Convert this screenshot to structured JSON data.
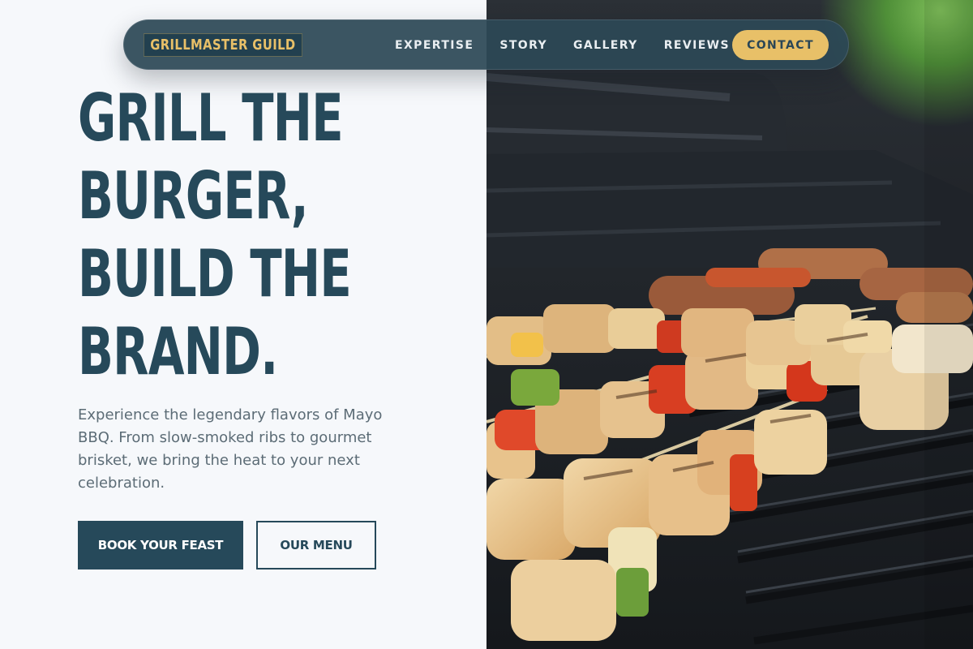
{
  "brand": {
    "logo_text": "GRILLMASTER GUILD"
  },
  "nav": {
    "links": [
      "EXPERTISE",
      "STORY",
      "GALLERY",
      "REVIEWS"
    ],
    "cta_label": "CONTACT"
  },
  "hero": {
    "title_lines": [
      "GRILL THE",
      "BURGER,",
      "BUILD THE",
      "BRAND."
    ],
    "description": "Experience the legendary flavors of Mayo BBQ. From slow-smoked ribs to gourmet brisket, we bring the heat to your next celebration.",
    "primary_button": "BOOK YOUR FEAST",
    "secondary_button": "OUR MENU"
  },
  "colors": {
    "navy": "#26495a",
    "gold": "#e8c068",
    "background": "#f6f8fb",
    "body_text": "#5c6c76"
  }
}
